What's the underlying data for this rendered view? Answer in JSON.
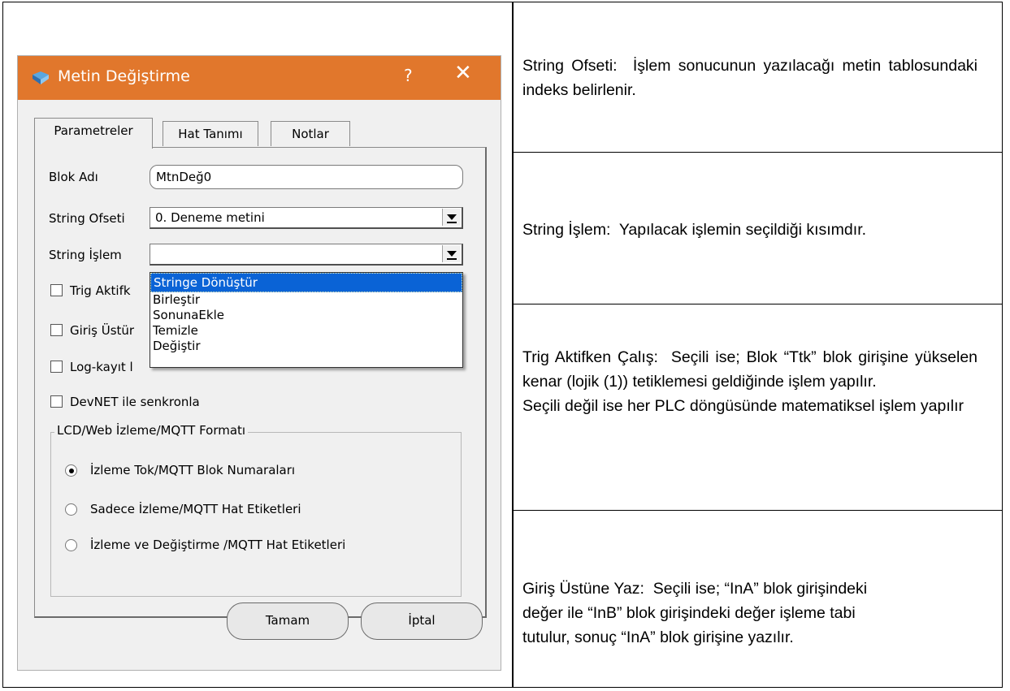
{
  "dialog": {
    "title": "Metin Değiştirme",
    "help": "?",
    "close": "✕",
    "tabs": [
      {
        "label": "Parametreler",
        "active": true
      },
      {
        "label": "Hat Tanımı",
        "active": false
      },
      {
        "label": "Notlar",
        "active": false
      }
    ],
    "block_name_label": "Blok Adı",
    "block_name_value": "MtnDeğ0",
    "string_offset_label": "String Ofseti",
    "string_offset_value": "0. Deneme metini",
    "string_op_label": "String İşlem",
    "string_op_value": "",
    "dropdown_options": [
      "Stringe Dönüştür",
      "Birleştir",
      "SonunaEkle",
      "Temizle",
      "Değiştir"
    ],
    "dropdown_selected": "Stringe Dönüştür",
    "checkboxes": [
      {
        "label": "Trig Aktifk",
        "checked": false
      },
      {
        "label": "Giriş Üstür",
        "checked": false
      },
      {
        "label": "Log-kayıt l",
        "checked": false
      },
      {
        "label": "DevNET ile senkronla",
        "checked": false
      }
    ],
    "group_label": "LCD/Web İzleme/MQTT Formatı",
    "radios": [
      {
        "label": "İzleme Tok/MQTT Blok Numaraları",
        "selected": true
      },
      {
        "label": "Sadece İzleme/MQTT Hat Etiketleri",
        "selected": false
      },
      {
        "label": "İzleme ve Değiştirme /MQTT Hat Etiketleri",
        "selected": false
      }
    ],
    "ok_label": "Tamam",
    "cancel_label": "İptal",
    "accent_color": "#e1772c"
  },
  "descriptions": {
    "offset_title": "String Ofseti:",
    "offset_text": "İşlem sonucunun yazılacağı metin tablosundaki indeks belirlenir.",
    "op_title": "String İşlem:",
    "op_text": "Yapılacak işlemin seçildiği kısımdır.",
    "trig_title": "Trig Aktifken Çalış:",
    "trig_text": "Seçili ise; Blok “Ttk” blok girişine yükselen kenar (lojik (1)) tetiklemesi geldiğinde işlem yapılır.",
    "trig_text2": "Seçili değil ise her PLC döngüsünde matematiksel işlem yapılır",
    "overwrite_title": "Giriş Üstüne Yaz:",
    "overwrite_line1": "Seçili ise; “InA” blok girişindeki",
    "overwrite_line2": "değer ile “InB” blok girişindeki değer işleme tabi",
    "overwrite_line3": "tutulur, sonuç “InA” blok girişine yazılır."
  }
}
